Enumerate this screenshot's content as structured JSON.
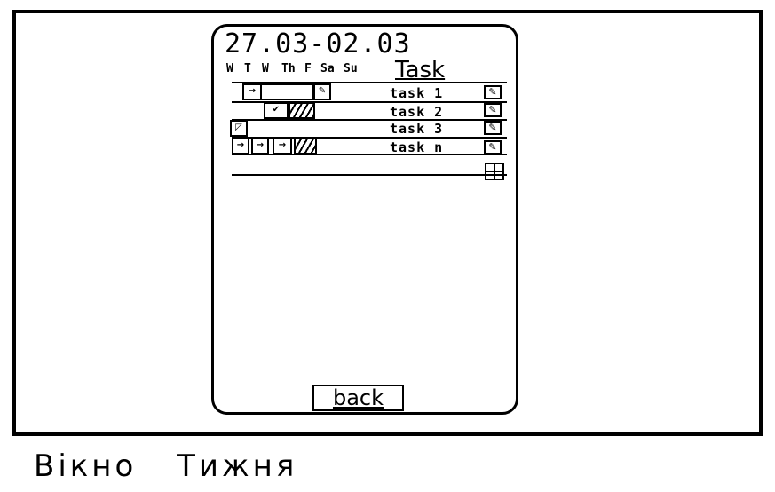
{
  "screen": {
    "date_range": "27.03-02.03",
    "days": [
      "W",
      "T",
      "W",
      "Th",
      "F",
      "Sa",
      "Su"
    ],
    "task_header": "Task",
    "back_label": "back",
    "tasks": [
      {
        "label": "task 1",
        "icon": "✎",
        "cells": [
          "→",
          "",
          "✎"
        ]
      },
      {
        "label": "task 2",
        "icon": "✎",
        "cells": [
          "✔",
          "▨"
        ]
      },
      {
        "label": "task 3",
        "icon": "✎",
        "cells": [
          "◸"
        ]
      },
      {
        "label": "task n",
        "icon": "✎",
        "cells": [
          "→",
          "→",
          "→",
          "▨"
        ]
      }
    ]
  },
  "caption": "Вікно Тижня"
}
